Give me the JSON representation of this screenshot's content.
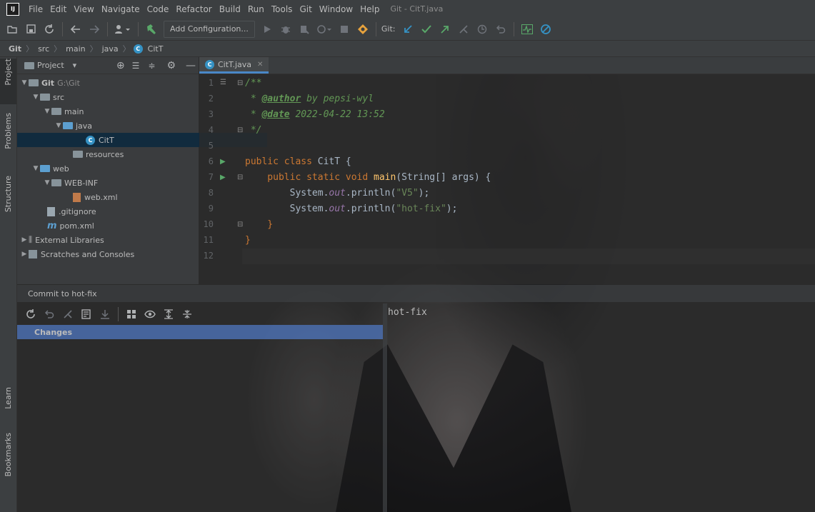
{
  "app": {
    "logo_text": "IJ",
    "window_title": "Git - CitT.java"
  },
  "menu": [
    "File",
    "Edit",
    "View",
    "Navigate",
    "Code",
    "Refactor",
    "Build",
    "Run",
    "Tools",
    "Git",
    "Window",
    "Help"
  ],
  "toolbar": {
    "run_config_label": "Add Configuration...",
    "git_label": "Git:"
  },
  "breadcrumb": [
    "Git",
    "src",
    "main",
    "java",
    "CitT"
  ],
  "left_strip": {
    "project": "Project",
    "problems": "Problems",
    "structure": "Structure",
    "learn": "Learn",
    "bookmarks": "Bookmarks"
  },
  "project_panel": {
    "title": "Project",
    "tree": [
      {
        "label": "Git",
        "suffix": "G:\\Git"
      },
      {
        "label": "src"
      },
      {
        "label": "main"
      },
      {
        "label": "java"
      },
      {
        "label": "CitT"
      },
      {
        "label": "resources"
      },
      {
        "label": "web"
      },
      {
        "label": "WEB-INF"
      },
      {
        "label": "web.xml"
      },
      {
        "label": ".gitignore"
      },
      {
        "label": "pom.xml"
      },
      {
        "label": "External Libraries"
      },
      {
        "label": "Scratches and Consoles"
      }
    ]
  },
  "editor": {
    "tab_label": "CitT.java",
    "line_numbers": [
      "1",
      "2",
      "3",
      "4",
      "5",
      "6",
      "7",
      "8",
      "9",
      "10",
      "11",
      "12"
    ],
    "code": {
      "l1": "/**",
      "l2_star": " * ",
      "l2_tag": "@author",
      "l2_text": " by pepsi-wyl",
      "l3_star": " * ",
      "l3_tag": "@date",
      "l3_text": " 2022-04-22 13:52",
      "l4": " */",
      "l6_kw": "public class ",
      "l6_name": "CitT {",
      "l7_kw": "    public static void ",
      "l7_fn": "main",
      "l7_rest": "(String[] args) {",
      "l8_pre": "        System.",
      "l8_fld": "out",
      "l8_mid": ".println(",
      "l8_str": "\"V5\"",
      "l8_end": ");",
      "l9_pre": "        System.",
      "l9_fld": "out",
      "l9_mid": ".println(",
      "l9_str": "\"hot-fix\"",
      "l9_end": ");",
      "l10": "    }",
      "l11": "}"
    }
  },
  "commit": {
    "panel_title": "Commit to hot-fix",
    "changes_label": "Changes",
    "message": "hot-fix"
  },
  "colors": {
    "accent": "#4a88c7",
    "selection": "#4b6eaf",
    "background": "#2b2b2b"
  }
}
